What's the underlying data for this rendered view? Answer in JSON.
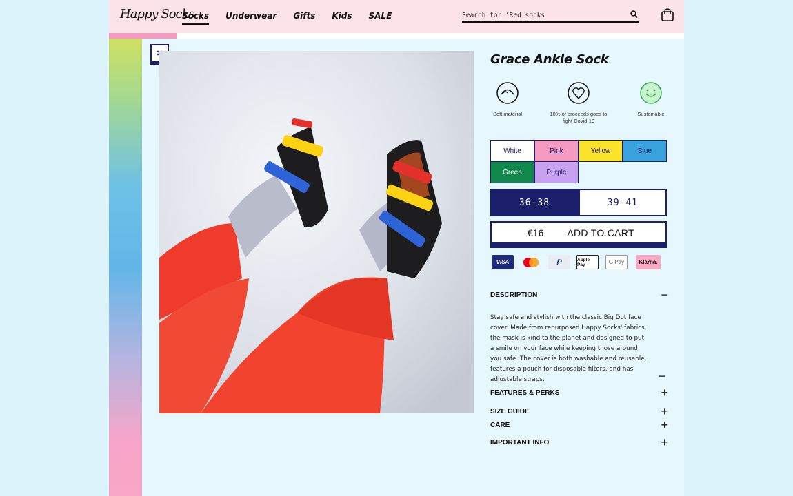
{
  "header": {
    "logo": "Happy Socks",
    "nav": [
      "Socks",
      "Underwear",
      "Gifts",
      "Kids",
      "SALE"
    ],
    "active_nav": "Socks",
    "search_placeholder": "Search for 'Red socks",
    "progress": 0.117
  },
  "product": {
    "title": "Grace Ankle Sock",
    "features": [
      {
        "icon": "smile-icon",
        "label": "Soft material"
      },
      {
        "icon": "heart-icon",
        "label": "10% of proceeds goes to fight Covid-19"
      },
      {
        "icon": "globe-smile-icon",
        "label": "Sustainable"
      }
    ],
    "colors": [
      {
        "label": "White",
        "hex": "#ffffff",
        "text": "#1b1e6a"
      },
      {
        "label": "Pink",
        "hex": "#f59ac0",
        "text": "#1b1e6a",
        "selected": true
      },
      {
        "label": "Yellow",
        "hex": "#fde42c",
        "text": "#1b1e6a"
      },
      {
        "label": "Blue",
        "hex": "#3aa2dc",
        "text": "#1b1e6a"
      },
      {
        "label": "Green",
        "hex": "#11894d",
        "text": "#ffffff"
      },
      {
        "label": "Purple",
        "hex": "#c8a0f0",
        "text": "#1b1e6a"
      }
    ],
    "sizes": [
      {
        "label": "36-38",
        "selected": true
      },
      {
        "label": "39-41",
        "selected": false
      }
    ],
    "price": "€16",
    "add_to_cart": "ADD TO CART",
    "payments": [
      "VISA",
      "mastercard",
      "PayPal",
      "Apple Pay",
      "G Pay",
      "Klarna."
    ],
    "accent": "#1b1e6a"
  },
  "accordion": {
    "description": {
      "title": "DESCRIPTION",
      "text": "Stay safe and stylish with the classic Big Dot face cover. Made from repurposed Happy Socks' fabrics, the mask is kind to the planet and designed to put a smile on your face while keeping those around you safe. The cover is both washable and reusable, features a pouch for disposable filters, and has adjustable straps.",
      "collapse_sign": "−"
    },
    "sections": [
      "FEATURES & PERKS",
      "SIZE GUIDE",
      "CARE",
      "IMPORTANT INFO"
    ],
    "expand_sign": "+"
  },
  "close_label": "×"
}
